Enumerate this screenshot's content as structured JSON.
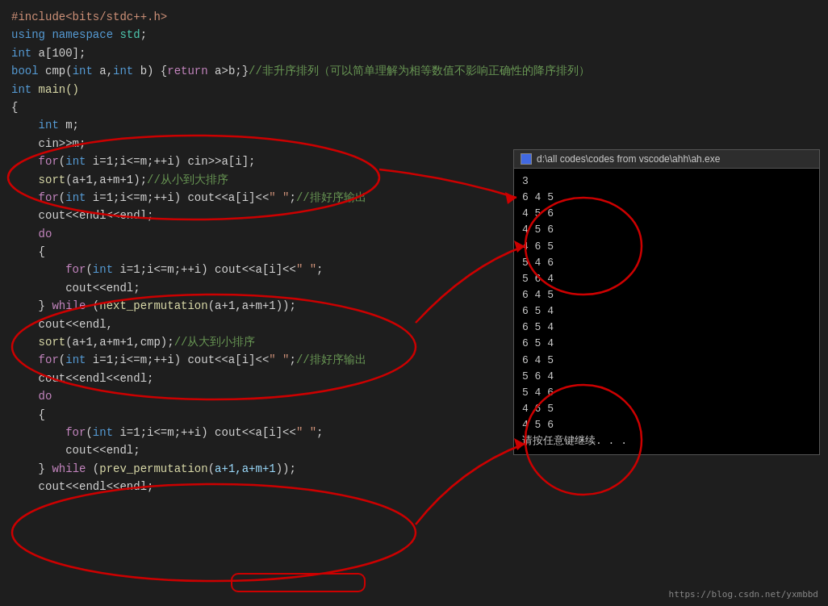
{
  "code": {
    "lines": [
      {
        "id": "l1",
        "tokens": [
          {
            "t": "#include<bits/stdc++.h>",
            "c": "inc"
          }
        ]
      },
      {
        "id": "l2",
        "tokens": [
          {
            "t": "using ",
            "c": "kw"
          },
          {
            "t": "namespace ",
            "c": "kw"
          },
          {
            "t": "std",
            "c": "ns"
          },
          {
            "t": ";",
            "c": "plain"
          }
        ]
      },
      {
        "id": "l3",
        "tokens": [
          {
            "t": "int ",
            "c": "kw"
          },
          {
            "t": "a[100];",
            "c": "plain"
          }
        ]
      },
      {
        "id": "l4",
        "tokens": [
          {
            "t": "bool ",
            "c": "kw"
          },
          {
            "t": "cmp(",
            "c": "plain"
          },
          {
            "t": "int ",
            "c": "kw"
          },
          {
            "t": "a,",
            "c": "plain"
          },
          {
            "t": "int ",
            "c": "kw"
          },
          {
            "t": "b) {",
            "c": "plain"
          },
          {
            "t": "return ",
            "c": "kw2"
          },
          {
            "t": "a>b;}",
            "c": "plain"
          },
          {
            "t": "//非升序排列（可以简单理解为相等数值不影响正确性的降序排列）",
            "c": "cmt"
          }
        ]
      },
      {
        "id": "l5",
        "tokens": [
          {
            "t": "int ",
            "c": "kw"
          },
          {
            "t": "main()",
            "c": "fn"
          }
        ]
      },
      {
        "id": "l6",
        "tokens": [
          {
            "t": "{",
            "c": "plain"
          }
        ]
      },
      {
        "id": "l7",
        "tokens": [
          {
            "t": "    ",
            "c": "plain"
          },
          {
            "t": "int ",
            "c": "kw"
          },
          {
            "t": "m;",
            "c": "plain"
          }
        ]
      },
      {
        "id": "l8",
        "tokens": [
          {
            "t": "    ",
            "c": "plain"
          },
          {
            "t": "cin>>m;",
            "c": "plain"
          }
        ]
      },
      {
        "id": "l9",
        "tokens": [
          {
            "t": "    ",
            "c": "plain"
          },
          {
            "t": "for",
            "c": "kw2"
          },
          {
            "t": "(",
            "c": "plain"
          },
          {
            "t": "int ",
            "c": "kw"
          },
          {
            "t": "i=1;i<=m;++i) cin>>a[i];",
            "c": "plain"
          }
        ]
      },
      {
        "id": "l10",
        "tokens": [
          {
            "t": "    ",
            "c": "plain"
          },
          {
            "t": "sort",
            "c": "fn"
          },
          {
            "t": "(a+1,a+m+1);",
            "c": "plain"
          },
          {
            "t": "//从小到大排序",
            "c": "cmt"
          }
        ]
      },
      {
        "id": "l11",
        "tokens": [
          {
            "t": "    ",
            "c": "plain"
          },
          {
            "t": "for",
            "c": "kw2"
          },
          {
            "t": "(",
            "c": "plain"
          },
          {
            "t": "int ",
            "c": "kw"
          },
          {
            "t": "i=1;i<=m;++i) cout<<a[i]<<",
            "c": "plain"
          },
          {
            "t": "\" \"",
            "c": "str"
          },
          {
            "t": ";",
            "c": "plain"
          },
          {
            "t": "//排好序输出",
            "c": "cmt"
          }
        ]
      },
      {
        "id": "l12",
        "tokens": [
          {
            "t": "    ",
            "c": "plain"
          },
          {
            "t": "cout<<endl<<endl;",
            "c": "plain"
          }
        ]
      },
      {
        "id": "l13",
        "tokens": [
          {
            "t": "    ",
            "c": "plain"
          },
          {
            "t": "do",
            "c": "kw2"
          }
        ]
      },
      {
        "id": "l14",
        "tokens": [
          {
            "t": "    ",
            "c": "plain"
          },
          {
            "t": "{",
            "c": "plain"
          }
        ]
      },
      {
        "id": "l15",
        "tokens": [
          {
            "t": "        ",
            "c": "plain"
          },
          {
            "t": "for",
            "c": "kw2"
          },
          {
            "t": "(",
            "c": "plain"
          },
          {
            "t": "int ",
            "c": "kw"
          },
          {
            "t": "i=1;i<=m;++i) cout<<a[i]<<",
            "c": "plain"
          },
          {
            "t": "\" \"",
            "c": "str"
          },
          {
            "t": ";",
            "c": "plain"
          }
        ]
      },
      {
        "id": "l16",
        "tokens": [
          {
            "t": "        ",
            "c": "plain"
          },
          {
            "t": "cout<<endl;",
            "c": "plain"
          }
        ]
      },
      {
        "id": "l17",
        "tokens": [
          {
            "t": "    ",
            "c": "plain"
          },
          {
            "t": "} ",
            "c": "plain"
          },
          {
            "t": "while ",
            "c": "kw2"
          },
          {
            "t": "(",
            "c": "plain"
          },
          {
            "t": "next_permutation",
            "c": "fn"
          },
          {
            "t": "(a+1,a+m+1));",
            "c": "plain"
          }
        ]
      },
      {
        "id": "l18",
        "tokens": [
          {
            "t": "    ",
            "c": "plain"
          },
          {
            "t": "cout<<endl,",
            "c": "plain"
          }
        ]
      },
      {
        "id": "l19",
        "tokens": [
          {
            "t": "    ",
            "c": "plain"
          },
          {
            "t": "sort",
            "c": "fn"
          },
          {
            "t": "(a+1,a+m+1,cmp);",
            "c": "plain"
          },
          {
            "t": "//从大到小排序",
            "c": "cmt"
          }
        ]
      },
      {
        "id": "l20",
        "tokens": [
          {
            "t": "    ",
            "c": "plain"
          },
          {
            "t": "for",
            "c": "kw2"
          },
          {
            "t": "(",
            "c": "plain"
          },
          {
            "t": "int ",
            "c": "kw"
          },
          {
            "t": "i=1;i<=m;++i) cout<<a[i]<<",
            "c": "plain"
          },
          {
            "t": "\" \"",
            "c": "str"
          },
          {
            "t": ";",
            "c": "plain"
          },
          {
            "t": "//排好序输出",
            "c": "cmt"
          }
        ]
      },
      {
        "id": "l21",
        "tokens": [
          {
            "t": "    ",
            "c": "plain"
          },
          {
            "t": "cout<<endl<<endl;",
            "c": "plain"
          }
        ]
      },
      {
        "id": "l22",
        "tokens": [
          {
            "t": "    ",
            "c": "plain"
          },
          {
            "t": "do",
            "c": "kw2"
          }
        ]
      },
      {
        "id": "l23",
        "tokens": [
          {
            "t": "    ",
            "c": "plain"
          },
          {
            "t": "{",
            "c": "plain"
          }
        ]
      },
      {
        "id": "l24",
        "tokens": [
          {
            "t": "        ",
            "c": "plain"
          },
          {
            "t": "for",
            "c": "kw2"
          },
          {
            "t": "(",
            "c": "plain"
          },
          {
            "t": "int ",
            "c": "kw"
          },
          {
            "t": "i=1;i<=m;++i) cout<<a[i]<<",
            "c": "plain"
          },
          {
            "t": "\" \"",
            "c": "str"
          },
          {
            "t": ";",
            "c": "plain"
          }
        ]
      },
      {
        "id": "l25",
        "tokens": [
          {
            "t": "        ",
            "c": "plain"
          },
          {
            "t": "cout<<endl;",
            "c": "plain"
          }
        ]
      },
      {
        "id": "l26",
        "tokens": [
          {
            "t": "    ",
            "c": "plain"
          },
          {
            "t": "} ",
            "c": "plain"
          },
          {
            "t": "while ",
            "c": "kw2"
          },
          {
            "t": "(",
            "c": "plain"
          },
          {
            "t": "prev_permutation",
            "c": "fn"
          },
          {
            "t": "(",
            "c": "plain"
          },
          {
            "t": "a+1,a+m+1",
            "c": "var"
          },
          {
            "t": "));",
            "c": "plain"
          }
        ]
      },
      {
        "id": "l27",
        "tokens": [
          {
            "t": "    ",
            "c": "plain"
          },
          {
            "t": "cout<<endl",
            "c": "plain"
          },
          {
            "t": "<<endl;",
            "c": "plain"
          }
        ]
      }
    ]
  },
  "terminal": {
    "title": "d:\\all codes\\codes from vscode\\ahh\\ah.exe",
    "lines": [
      "3",
      "6 4 5",
      "4 5 6",
      "",
      "4 5 6",
      "4 6 5",
      "5 4 6",
      "5 6 4",
      "6 4 5",
      "6 5 4",
      "",
      "6 5 4",
      "",
      "6 5 4",
      "6 4 5",
      "5 6 4",
      "5 4 6",
      "4 6 5",
      "4 5 6",
      "",
      "请按任意键继续. . ."
    ]
  },
  "footer": {
    "url": "https://blog.csdn.net/yxmbbd"
  }
}
